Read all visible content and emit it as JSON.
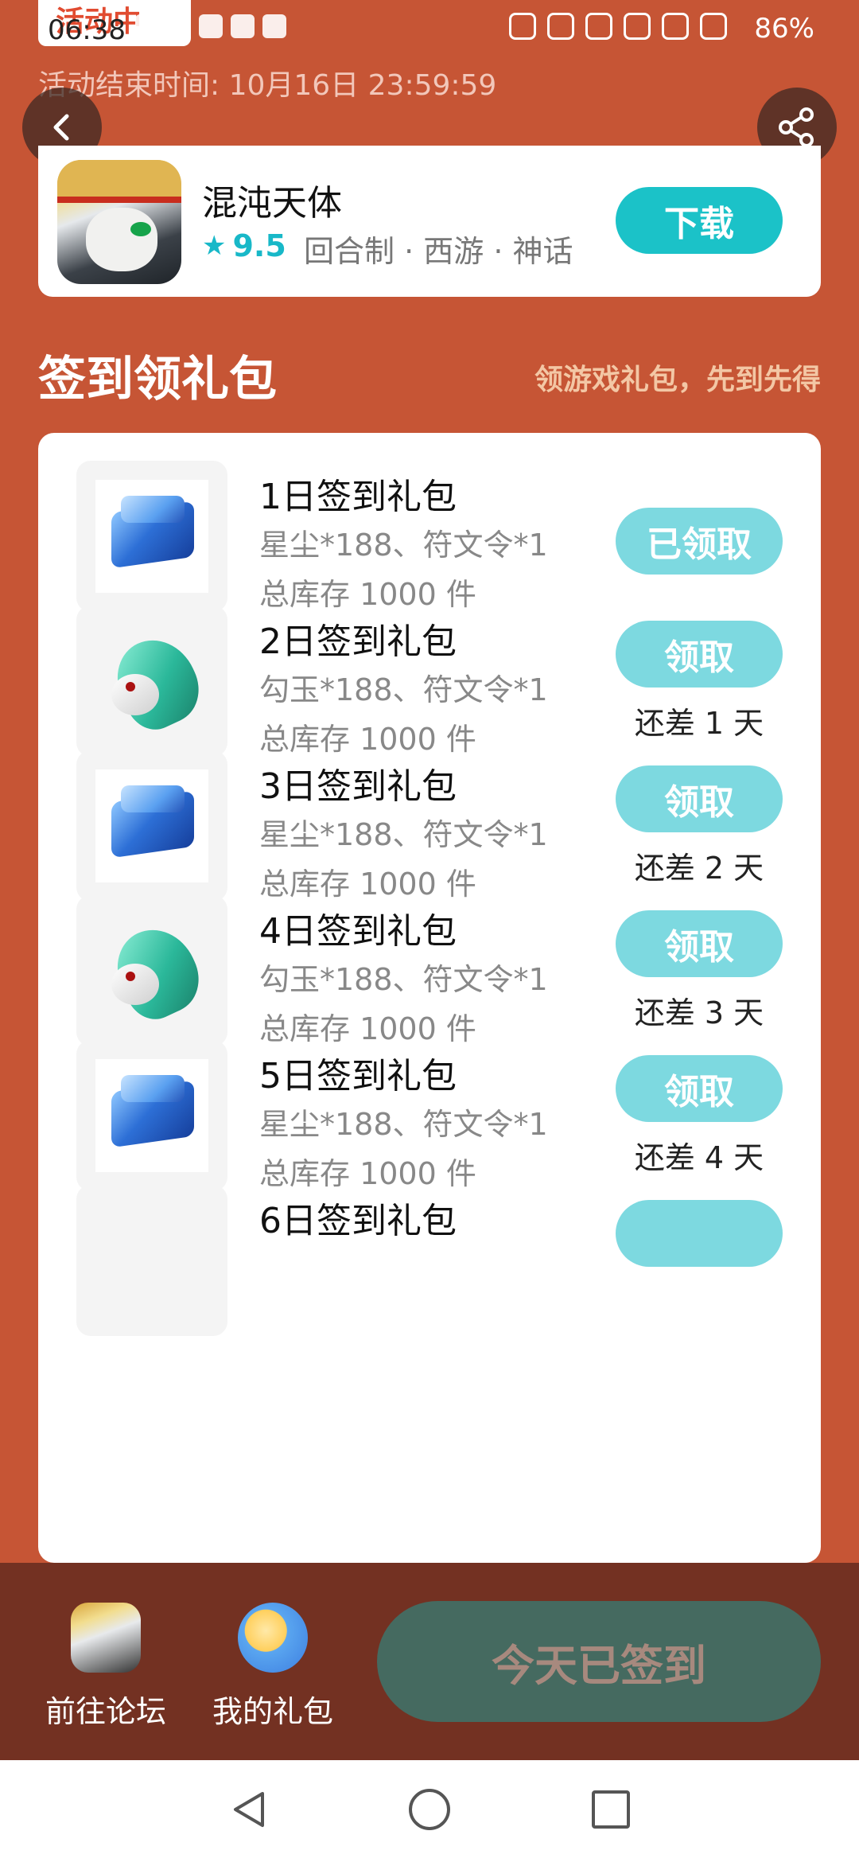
{
  "status_bar": {
    "time": "06:38",
    "battery": "86%"
  },
  "activity_tag": "活动中",
  "activity_end": "活动结束时间: 10月16日 23:59:59",
  "icons": {
    "back": "back-arrow-icon",
    "share": "share-icon"
  },
  "game": {
    "name": "混沌天体",
    "rating_star": "★",
    "rating": "9.5",
    "tags": "回合制 · 西游 · 神话",
    "download_label": "下载"
  },
  "section": {
    "title": "签到领礼包",
    "subtitle": "领游戏礼包，先到先得"
  },
  "gifts": [
    {
      "name": "1日签到礼包",
      "items": "星尘*188、符文令*1",
      "stock": "总库存 1000 件",
      "button": "已领取",
      "days_left": "",
      "icon": "chest"
    },
    {
      "name": "2日签到礼包",
      "items": "勾玉*188、符文令*1",
      "stock": "总库存 1000 件",
      "button": "领取",
      "days_left": "还差 1 天",
      "icon": "jade"
    },
    {
      "name": "3日签到礼包",
      "items": "星尘*188、符文令*1",
      "stock": "总库存 1000 件",
      "button": "领取",
      "days_left": "还差 2 天",
      "icon": "chest"
    },
    {
      "name": "4日签到礼包",
      "items": "勾玉*188、符文令*1",
      "stock": "总库存 1000 件",
      "button": "领取",
      "days_left": "还差 3 天",
      "icon": "jade"
    },
    {
      "name": "5日签到礼包",
      "items": "星尘*188、符文令*1",
      "stock": "总库存 1000 件",
      "button": "领取",
      "days_left": "还差 4 天",
      "icon": "chest"
    },
    {
      "name": "6日签到礼包",
      "items": "",
      "stock": "",
      "button": "",
      "days_left": "",
      "icon": "jade"
    }
  ],
  "bottom_bar": {
    "forum_label": "前往论坛",
    "my_gifts_label": "我的礼包",
    "signed_label": "今天已签到"
  },
  "nav": {
    "back": "nav-back-icon",
    "home": "nav-home-icon",
    "recent": "nav-recent-icon"
  }
}
